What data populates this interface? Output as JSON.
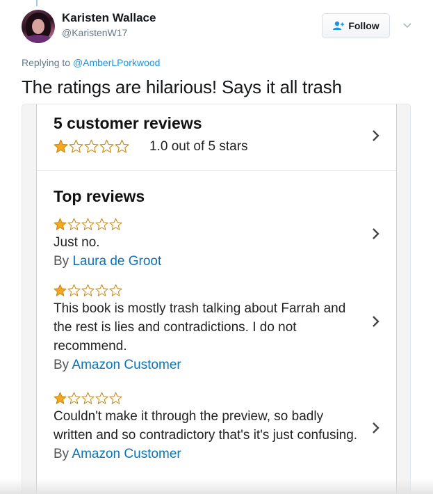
{
  "tweet": {
    "author_name": "Karisten Wallace",
    "author_handle": "@KaristenW17",
    "follow_label": "Follow",
    "replying_prefix": "Replying to",
    "replying_to": "@AmberLPorkwood",
    "text": "The ratings are hilarious! Says it all trash"
  },
  "review_card": {
    "summary_title": "5 customer reviews",
    "summary_rating_text": "1.0 out of 5 stars",
    "summary_stars_filled": 1,
    "stars_total": 5,
    "top_reviews_title": "Top reviews",
    "by_label": "By",
    "reviews": [
      {
        "stars_filled": 1,
        "text": "Just no.",
        "author": "Laura de Groot"
      },
      {
        "stars_filled": 1,
        "text": "This book is mostly trash talking about Farrah and the rest is lies and contradictions. I do not recommend.",
        "author": "Amazon Customer"
      },
      {
        "stars_filled": 1,
        "text": "Couldn't make it through the preview, so badly written and so contradictory that's it's just confusing.",
        "author": "Amazon Customer"
      }
    ]
  },
  "colors": {
    "star_fill": "#f5a623",
    "star_outline": "#c88a12",
    "link": "#1b95e0",
    "author_link": "#0d73b5",
    "follow_icon": "#1b95e0"
  }
}
